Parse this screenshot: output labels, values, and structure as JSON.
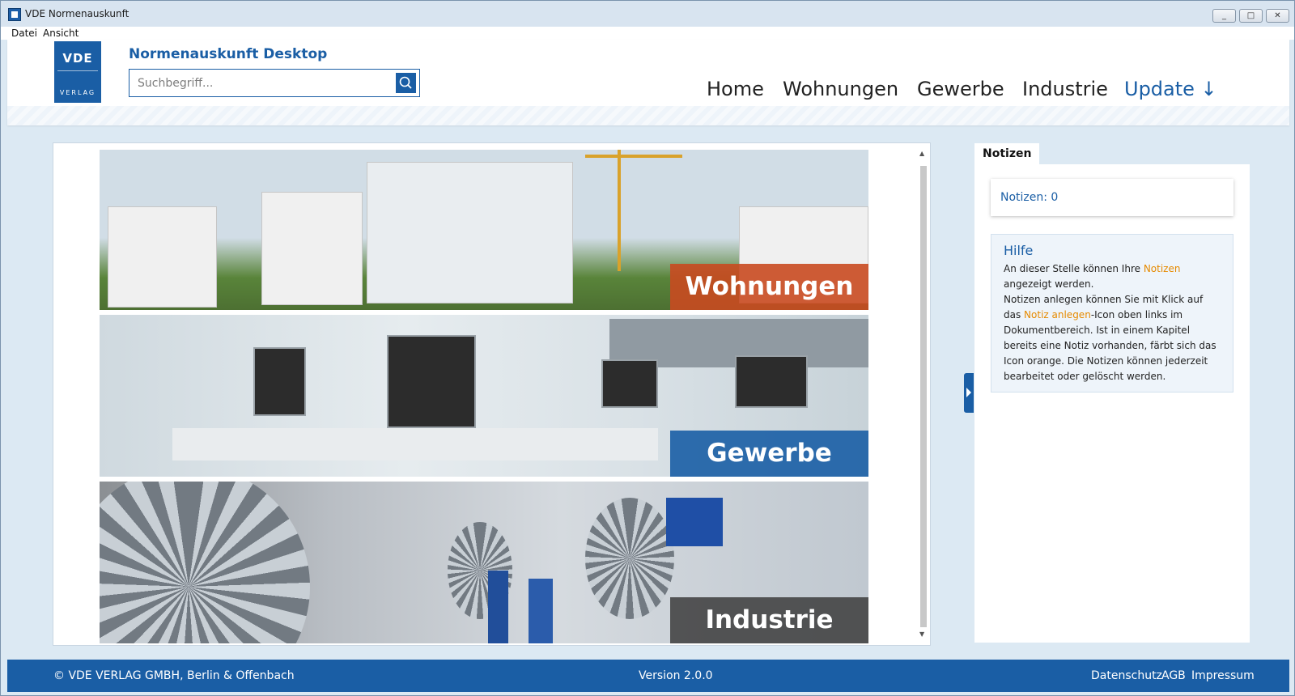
{
  "window": {
    "title": "VDE Normenauskunft",
    "controls": {
      "minimize": "_",
      "maximize": "□",
      "close": "✕"
    }
  },
  "menu": [
    "Datei",
    "Ansicht"
  ],
  "header": {
    "logo_top": "VDE",
    "logo_bottom": "VERLAG",
    "app_name": "Normenauskunft Desktop",
    "search_placeholder": "Suchbegriff...",
    "search_icon": "search-icon",
    "nav": {
      "home": "Home",
      "wohnungen": "Wohnungen",
      "gewerbe": "Gewerbe",
      "industrie": "Industrie",
      "update": "Update ↓"
    }
  },
  "banners": [
    {
      "label": "Wohnungen",
      "label_color": "#c94a20"
    },
    {
      "label": "Gewerbe",
      "label_color": "#1a5ea5"
    },
    {
      "label": "Industrie",
      "label_color": "#4a4a4a"
    }
  ],
  "notes": {
    "tab": "Notizen",
    "count": "Notizen: 0",
    "help_title": "Hilfe",
    "help_parts": [
      "An dieser Stelle können Ihre ",
      "Notizen",
      " angezeigt werden.",
      "Notizen anlegen können Sie mit Klick auf das ",
      "Notiz anlegen",
      "-Icon oben links im Dokumentbereich. Ist in einem Kapitel bereits eine Notiz vorhanden, färbt sich das Icon orange. Die Notizen können jederzeit bearbeitet oder gelöscht werden."
    ]
  },
  "footer": {
    "copyright": "© VDE VERLAG GMBH, Berlin & Offenbach",
    "version": "Version 2.0.0",
    "links": {
      "datenschutz": "Datenschutz",
      "agb": "AGB",
      "impressum": "Impressum"
    }
  },
  "colors": {
    "brand": "#1a5ea5",
    "highlight": "#e68a00",
    "background": "#dce9f3"
  }
}
